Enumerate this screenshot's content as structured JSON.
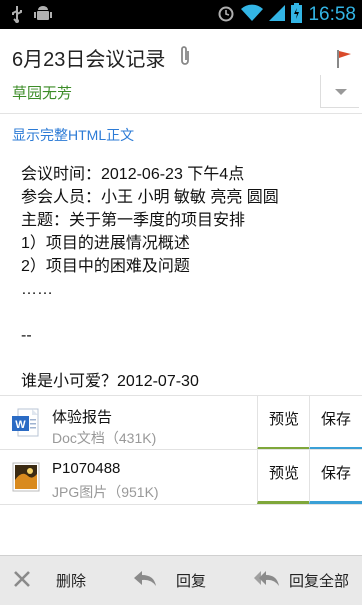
{
  "status_bar": {
    "time": "16:58",
    "icons": [
      "usb-icon",
      "android-debug-icon",
      "alarm-icon",
      "wifi-icon",
      "signal-icon",
      "battery-icon"
    ]
  },
  "header": {
    "subject": "6月23日会议记录",
    "sender": "草园无芳"
  },
  "show_full_html": "显示完整HTML正文",
  "body_lines": [
    "会议时间：2012-06-23 下午4点",
    "参会人员：小王 小明 敏敏 亮亮 圆圆",
    "主题：关于第一季度的项目安排",
    "1）项目的进展情况概述",
    "2）项目中的困难及问题",
    "……",
    "",
    "--",
    "",
    "谁是小可爱？2012-07-30"
  ],
  "attachments": [
    {
      "name": "体验报告",
      "meta": "Doc文档（431K)",
      "icon": "doc-file-icon",
      "preview": "预览",
      "save": "保存"
    },
    {
      "name": "P1070488",
      "meta": "JPG图片（951K)",
      "icon": "image-file-icon",
      "preview": "预览",
      "save": "保存"
    }
  ],
  "bottom_bar": {
    "delete": "删除",
    "reply": "回复",
    "reply_all": "回复全部"
  },
  "colors": {
    "status_accent": "#33b5e5",
    "sender_green": "#3c8c27",
    "link_blue": "#2c7bd6",
    "preview_underline": "#7fa73a",
    "save_underline": "#3aa0d6",
    "flag_red": "#d94a2a"
  }
}
